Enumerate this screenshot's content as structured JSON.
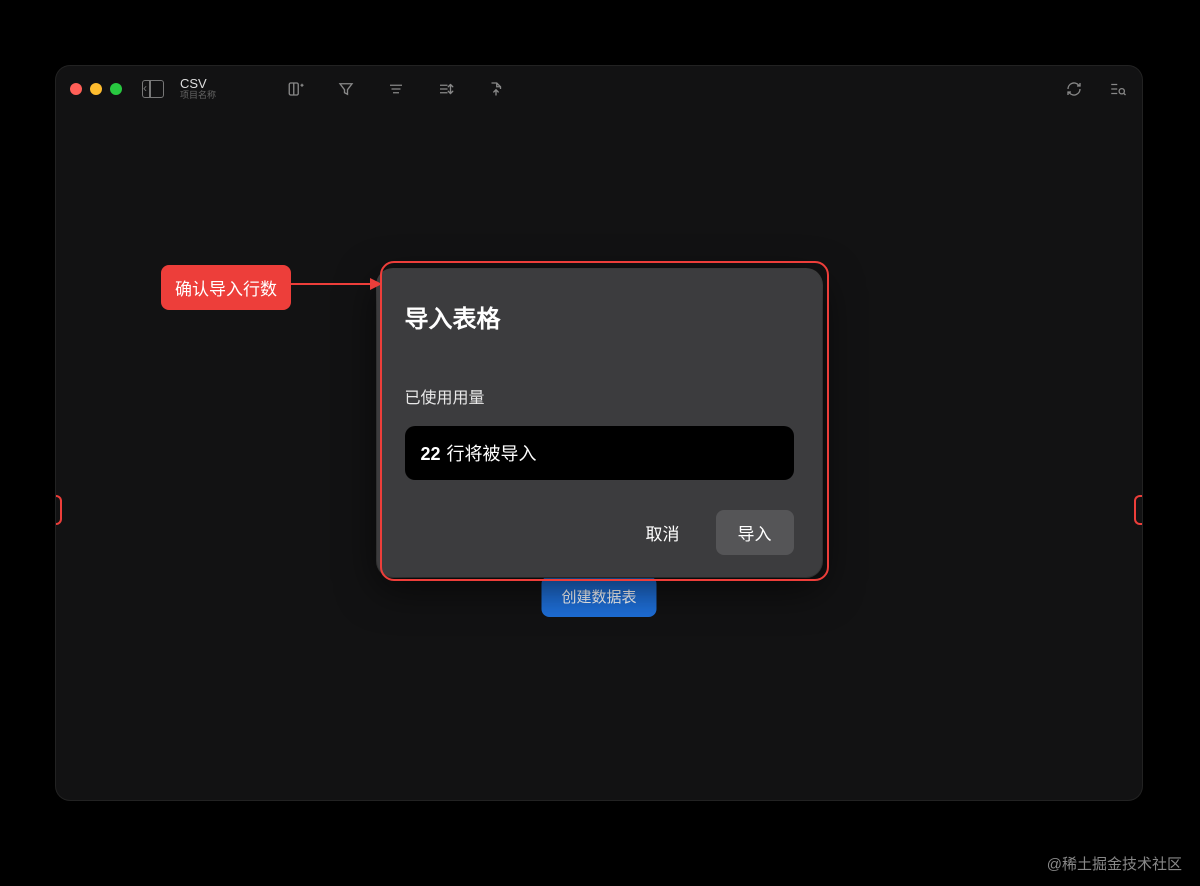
{
  "window": {
    "title": "CSV",
    "subtitle": "项目名称"
  },
  "background_button": {
    "label": "创建数据表"
  },
  "dialog": {
    "title": "导入表格",
    "usage_label": "已使用用量",
    "row_count": "22",
    "row_suffix": "行将被导入",
    "cancel": "取消",
    "confirm": "导入"
  },
  "annotation": {
    "callout": "确认导入行数"
  },
  "watermark": "@稀土掘金技术社区",
  "colors": {
    "accent_red": "#ed3e3a",
    "accent_blue": "#1e6fd9"
  }
}
